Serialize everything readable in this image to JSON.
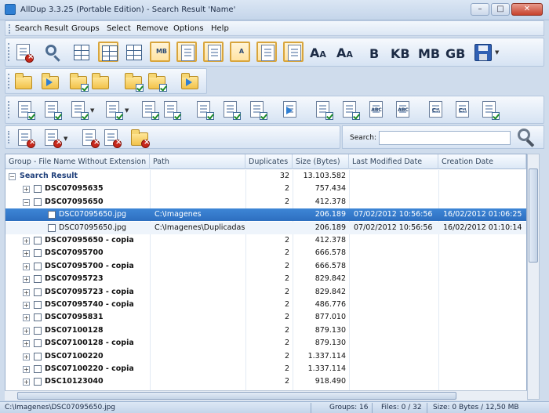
{
  "window": {
    "title": "AllDup 3.3.25 (Portable Edition) - Search Result 'Name'",
    "controls": [
      "–",
      "□",
      "✕"
    ]
  },
  "menu": [
    "Search Result",
    "Groups",
    "Select",
    "Remove",
    "Options",
    "Help"
  ],
  "toolbar": {
    "size_units": [
      "B",
      "KB",
      "MB",
      "GB"
    ],
    "mb_button": "MB",
    "abc_label": "ABC",
    "c_label": "C:\\",
    "a_label": "A"
  },
  "search": {
    "label": "Search:",
    "value": ""
  },
  "table": {
    "columns": [
      "Group - File Name Without Extension",
      "Path",
      "Duplicates",
      "Size (Bytes)",
      "Last Modified Date",
      "Creation Date"
    ],
    "rows": [
      {
        "kind": "root",
        "expander": "−",
        "name": "Search Result",
        "path": "",
        "dup": "32",
        "size": "13.103.582",
        "modified": "",
        "created": ""
      },
      {
        "kind": "group",
        "expander": "+",
        "name": "DSC07095635",
        "path": "",
        "dup": "2",
        "size": "757.434",
        "modified": "",
        "created": ""
      },
      {
        "kind": "group",
        "expander": "−",
        "name": "DSC07095650",
        "path": "",
        "dup": "2",
        "size": "412.378",
        "modified": "",
        "created": ""
      },
      {
        "kind": "file-selected",
        "expander": "",
        "name": "DSC07095650.jpg",
        "path": "C:\\Imagenes",
        "dup": "",
        "size": "206.189",
        "modified": "07/02/2012 10:56:56",
        "created": "16/02/2012 01:06:25"
      },
      {
        "kind": "file",
        "expander": "",
        "name": "DSC07095650.jpg",
        "path": "C:\\Imagenes\\Duplicadas",
        "dup": "",
        "size": "206.189",
        "modified": "07/02/2012 10:56:56",
        "created": "16/02/2012 01:10:14"
      },
      {
        "kind": "group",
        "expander": "+",
        "name": "DSC07095650 - copia",
        "path": "",
        "dup": "2",
        "size": "412.378",
        "modified": "",
        "created": ""
      },
      {
        "kind": "group",
        "expander": "+",
        "name": "DSC07095700",
        "path": "",
        "dup": "2",
        "size": "666.578",
        "modified": "",
        "created": ""
      },
      {
        "kind": "group",
        "expander": "+",
        "name": "DSC07095700 - copia",
        "path": "",
        "dup": "2",
        "size": "666.578",
        "modified": "",
        "created": ""
      },
      {
        "kind": "group",
        "expander": "+",
        "name": "DSC07095723",
        "path": "",
        "dup": "2",
        "size": "829.842",
        "modified": "",
        "created": ""
      },
      {
        "kind": "group",
        "expander": "+",
        "name": "DSC07095723 - copia",
        "path": "",
        "dup": "2",
        "size": "829.842",
        "modified": "",
        "created": ""
      },
      {
        "kind": "group",
        "expander": "+",
        "name": "DSC07095740 - copia",
        "path": "",
        "dup": "2",
        "size": "486.776",
        "modified": "",
        "created": ""
      },
      {
        "kind": "group",
        "expander": "+",
        "name": "DSC07095831",
        "path": "",
        "dup": "2",
        "size": "877.010",
        "modified": "",
        "created": ""
      },
      {
        "kind": "group",
        "expander": "+",
        "name": "DSC07100128",
        "path": "",
        "dup": "2",
        "size": "879.130",
        "modified": "",
        "created": ""
      },
      {
        "kind": "group",
        "expander": "+",
        "name": "DSC07100128 - copia",
        "path": "",
        "dup": "2",
        "size": "879.130",
        "modified": "",
        "created": ""
      },
      {
        "kind": "group",
        "expander": "+",
        "name": "DSC07100220",
        "path": "",
        "dup": "2",
        "size": "1.337.114",
        "modified": "",
        "created": ""
      },
      {
        "kind": "group",
        "expander": "+",
        "name": "DSC07100220 - copia",
        "path": "",
        "dup": "2",
        "size": "1.337.114",
        "modified": "",
        "created": ""
      },
      {
        "kind": "group",
        "expander": "+",
        "name": "DSC10123040",
        "path": "",
        "dup": "2",
        "size": "918.490",
        "modified": "",
        "created": ""
      }
    ]
  },
  "status": {
    "path": "C:\\Imagenes\\DSC07095650.jpg",
    "groups": "Groups: 16",
    "files": "Files: 0 / 32",
    "size": "Size: 0 Bytes / 12,50 MB"
  },
  "colors": {
    "selection": "#3e86d6",
    "root_text": "#1f3f7a",
    "chrome": "#cfdcec"
  }
}
